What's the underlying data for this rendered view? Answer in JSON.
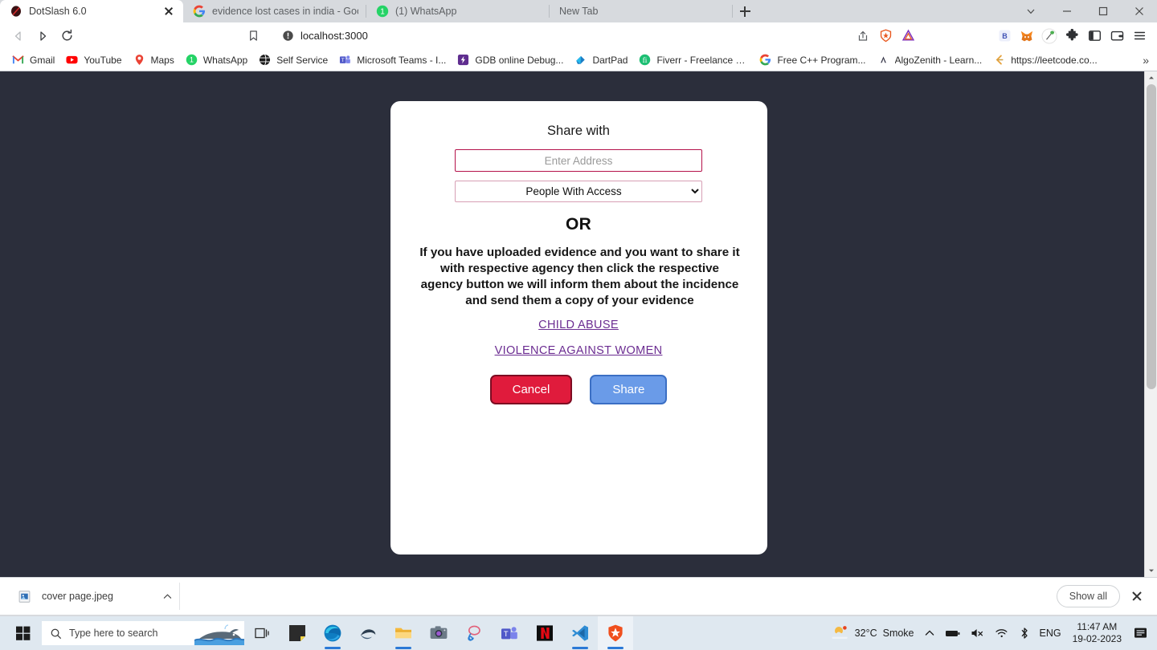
{
  "browser": {
    "tabs": [
      {
        "title": "DotSlash 6.0",
        "favicon": "dotslash-icon",
        "active": true,
        "closable": true
      },
      {
        "title": "evidence lost cases in india - Google S",
        "favicon": "google-icon",
        "active": false
      },
      {
        "title": "(1) WhatsApp",
        "favicon": "whatsapp-icon",
        "active": false
      },
      {
        "title": "New Tab",
        "favicon": "none",
        "active": false
      }
    ],
    "new_tab_label": "+",
    "window_controls": [
      "tab-search-chevron",
      "minimize",
      "maximize",
      "close"
    ],
    "nav": {
      "back": "back-arrow",
      "forward": "forward-arrow",
      "reload": "reload-icon",
      "bookmark": "bookmark-icon",
      "site_info": "not-secure-icon",
      "url": "localhost:3000",
      "share": "share-icon",
      "brave_shields": "brave-shields-icon",
      "brave_rewards": "brave-rewards-icon"
    },
    "extensions": [
      "b-extension-icon",
      "metamask-fox-icon",
      "mouse-extension-icon",
      "puzzle-extensions-icon",
      "sidebar-icon",
      "wallet-icon",
      "menu-hamburger-icon"
    ],
    "bookmarks": [
      {
        "label": "Gmail",
        "icon": "gmail-icon"
      },
      {
        "label": "YouTube",
        "icon": "youtube-icon"
      },
      {
        "label": "Maps",
        "icon": "maps-icon"
      },
      {
        "label": "WhatsApp",
        "icon": "whatsapp-icon"
      },
      {
        "label": "Self Service",
        "icon": "self-service-icon"
      },
      {
        "label": "Microsoft Teams - I...",
        "icon": "teams-icon"
      },
      {
        "label": "GDB online Debug...",
        "icon": "gdb-icon"
      },
      {
        "label": "DartPad",
        "icon": "dartpad-icon"
      },
      {
        "label": "Fiverr - Freelance S...",
        "icon": "fiverr-icon"
      },
      {
        "label": "Free C++ Program...",
        "icon": "google-icon"
      },
      {
        "label": "AlgoZenith - Learn...",
        "icon": "algozenith-icon"
      },
      {
        "label": "https://leetcode.co...",
        "icon": "leetcode-icon"
      }
    ],
    "bookmarks_overflow": "»"
  },
  "page": {
    "background_color": "#2b2e3b",
    "modal": {
      "title": "Share with",
      "address_input": {
        "value": "",
        "placeholder": "Enter Address"
      },
      "access_select": {
        "selected": "People With Access",
        "options": [
          "People With Access"
        ]
      },
      "or_label": "OR",
      "description": "If you have uploaded evidence and you want to share it with respective agency then click the respective agency button we will inform them about the incidence and send them a copy of your evidence",
      "agency_links": [
        "CHILD ABUSE",
        "VIOLENCE AGAINST WOMEN"
      ],
      "cancel_label": "Cancel",
      "share_label": "Share",
      "cancel_color": "#e01b3c",
      "share_color": "#6a9be8",
      "input_border_color": "#b4124a",
      "link_color": "#6b2c91"
    }
  },
  "downloads": {
    "file_name": "cover page.jpeg",
    "file_icon": "image-file-icon",
    "expand_icon": "chevron-up-icon",
    "show_all_label": "Show all",
    "close_icon": "close-icon"
  },
  "taskbar": {
    "start_label": "start-icon",
    "search_placeholder": "Type here to search",
    "search_icon": "search-icon",
    "task_view": "task-view-icon",
    "apps": [
      {
        "name": "sticky-notes-icon",
        "running": false
      },
      {
        "name": "microsoft-edge-icon",
        "running": true
      },
      {
        "name": "photos-viewer-icon",
        "running": false
      },
      {
        "name": "file-explorer-icon",
        "running": true
      },
      {
        "name": "camera-icon",
        "running": false
      },
      {
        "name": "paint-icon",
        "running": false
      },
      {
        "name": "microsoft-teams-icon",
        "running": false
      },
      {
        "name": "netflix-icon",
        "running": false
      },
      {
        "name": "vs-code-icon",
        "running": true
      },
      {
        "name": "brave-browser-icon",
        "running": true
      }
    ],
    "tray": {
      "weather_temp": "32°C",
      "weather_condition": "Smoke",
      "overflow_icon": "chevron-up-icon",
      "battery_icon": "battery-icon",
      "volume_icon": "volume-muted-icon",
      "wifi_icon": "wifi-icon",
      "bluetooth_icon": "bluetooth-icon",
      "language": "ENG",
      "time": "11:47 AM",
      "date": "19-02-2023",
      "notifications_icon": "notifications-icon"
    }
  }
}
